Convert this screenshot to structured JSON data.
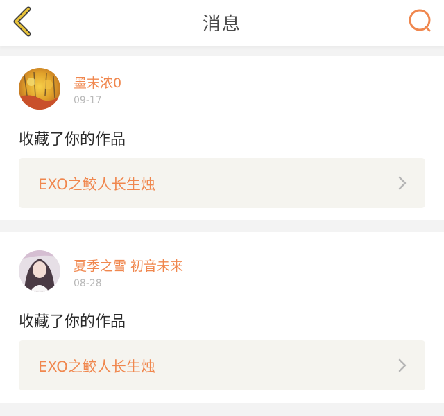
{
  "header": {
    "title": "消息",
    "back_icon": "chevron-left-icon",
    "search_icon": "search-icon",
    "accent_color": "#f0874e",
    "back_color": "#e8c33a"
  },
  "notifications": [
    {
      "username": "墨末浓0",
      "date": "09-17",
      "action": "收藏了你的作品",
      "work_title": "EXO之鲛人长生烛"
    },
    {
      "username": "夏季之雪 初音未来",
      "date": "08-28",
      "action": "收藏了你的作品",
      "work_title": "EXO之鲛人长生烛"
    }
  ]
}
